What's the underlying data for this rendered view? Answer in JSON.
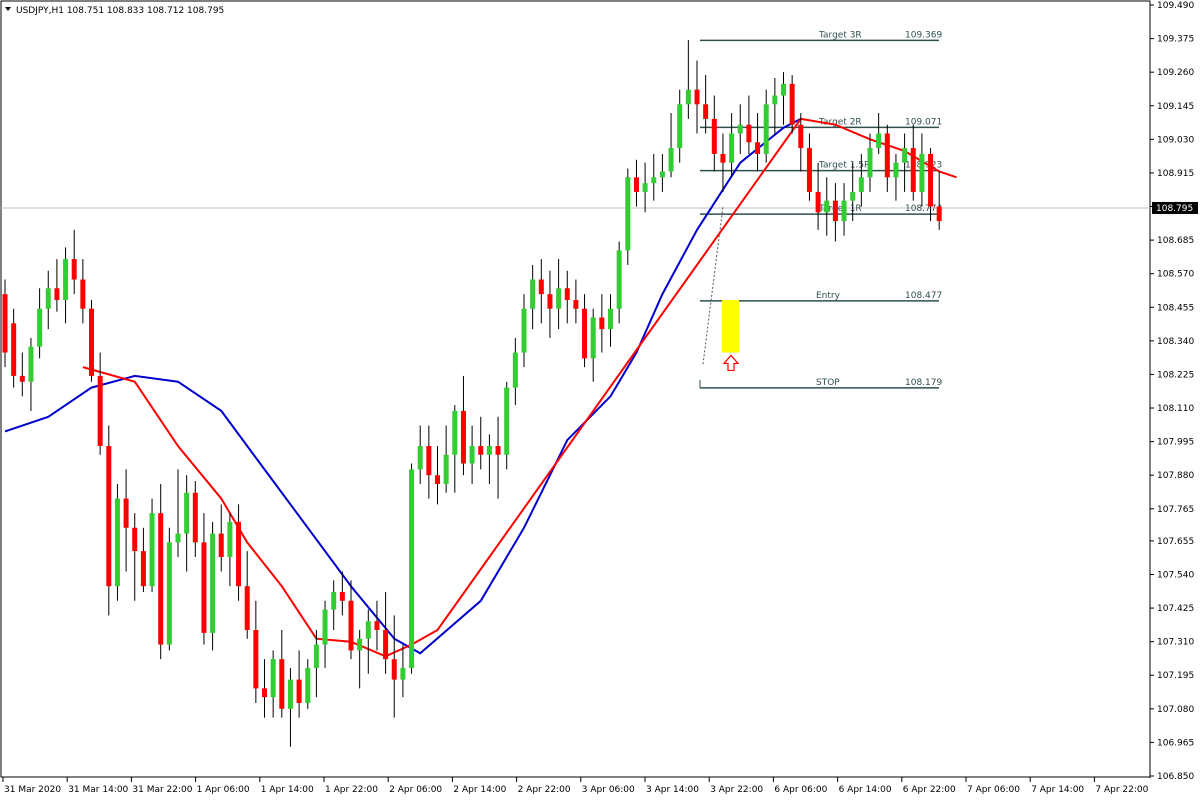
{
  "header": {
    "title": "USDJPY,H1  108.751 108.833 108.712 108.795"
  },
  "colors": {
    "bull": "#32cd32",
    "bear": "#ff0000",
    "wick": "#000000",
    "ma_fast": "#0000cd",
    "ma_slow": "#ff0000",
    "level": "#2f4f4f",
    "highlight": "#ffff00",
    "arrow": "#ff0000",
    "grid": "#c0c0c0",
    "price_line": "#c0c0c0",
    "price_tag_bg": "#000000",
    "price_tag_fg": "#ffffff"
  },
  "chart_data": {
    "type": "candlestick",
    "symbol": "USDJPY",
    "timeframe": "H1",
    "ylim": [
      106.85,
      109.49
    ],
    "y_ticks": [
      "109.490",
      "109.375",
      "109.260",
      "109.145",
      "109.030",
      "108.915",
      "108.800",
      "108.685",
      "108.570",
      "108.455",
      "108.340",
      "108.225",
      "108.110",
      "107.995",
      "107.880",
      "107.765",
      "107.655",
      "107.540",
      "107.425",
      "107.310",
      "107.195",
      "107.080",
      "106.965",
      "106.850"
    ],
    "x_ticks": [
      "31 Mar 2020",
      "31 Mar 14:00",
      "31 Mar 22:00",
      "1 Apr 06:00",
      "1 Apr 14:00",
      "1 Apr 22:00",
      "2 Apr 06:00",
      "2 Apr 14:00",
      "2 Apr 22:00",
      "3 Apr 06:00",
      "3 Apr 14:00",
      "3 Apr 22:00",
      "6 Apr 06:00",
      "6 Apr 14:00",
      "6 Apr 22:00",
      "7 Apr 06:00",
      "7 Apr 14:00",
      "7 Apr 22:00"
    ],
    "current_price": "108.795",
    "bars": [
      [
        108.5,
        108.55,
        108.25,
        108.3
      ],
      [
        108.4,
        108.45,
        108.18,
        108.22
      ],
      [
        108.22,
        108.3,
        108.15,
        108.2
      ],
      [
        108.2,
        108.35,
        108.1,
        108.32
      ],
      [
        108.32,
        108.52,
        108.28,
        108.45
      ],
      [
        108.45,
        108.58,
        108.38,
        108.52
      ],
      [
        108.52,
        108.62,
        108.44,
        108.48
      ],
      [
        108.48,
        108.66,
        108.4,
        108.62
      ],
      [
        108.62,
        108.72,
        108.5,
        108.55
      ],
      [
        108.55,
        108.62,
        108.4,
        108.45
      ],
      [
        108.45,
        108.48,
        108.2,
        108.22
      ],
      [
        108.22,
        108.3,
        107.95,
        107.98
      ],
      [
        107.98,
        108.05,
        107.4,
        107.5
      ],
      [
        107.5,
        107.85,
        107.45,
        107.8
      ],
      [
        107.8,
        107.9,
        107.55,
        107.7
      ],
      [
        107.7,
        107.75,
        107.45,
        107.62
      ],
      [
        107.62,
        107.7,
        107.48,
        107.5
      ],
      [
        107.5,
        107.8,
        107.48,
        107.75
      ],
      [
        107.75,
        107.85,
        107.25,
        107.3
      ],
      [
        107.3,
        107.7,
        107.28,
        107.65
      ],
      [
        107.65,
        107.9,
        107.6,
        107.68
      ],
      [
        107.68,
        107.88,
        107.55,
        107.82
      ],
      [
        107.82,
        107.86,
        107.6,
        107.65
      ],
      [
        107.65,
        107.75,
        107.3,
        107.34
      ],
      [
        107.34,
        107.72,
        107.28,
        107.68
      ],
      [
        107.68,
        107.78,
        107.55,
        107.6
      ],
      [
        107.6,
        107.75,
        107.5,
        107.72
      ],
      [
        107.72,
        107.78,
        107.45,
        107.5
      ],
      [
        107.5,
        107.62,
        107.32,
        107.35
      ],
      [
        107.35,
        107.45,
        107.1,
        107.15
      ],
      [
        107.15,
        107.25,
        107.05,
        107.12
      ],
      [
        107.12,
        107.28,
        107.05,
        107.25
      ],
      [
        107.25,
        107.35,
        107.05,
        107.08
      ],
      [
        107.08,
        107.22,
        106.95,
        107.18
      ],
      [
        107.18,
        107.28,
        107.05,
        107.1
      ],
      [
        107.1,
        107.25,
        107.08,
        107.22
      ],
      [
        107.22,
        107.35,
        107.12,
        107.3
      ],
      [
        107.3,
        107.45,
        107.22,
        107.42
      ],
      [
        107.42,
        107.52,
        107.35,
        107.48
      ],
      [
        107.48,
        107.55,
        107.4,
        107.45
      ],
      [
        107.45,
        107.52,
        107.25,
        107.28
      ],
      [
        107.28,
        107.35,
        107.15,
        107.32
      ],
      [
        107.32,
        107.42,
        107.2,
        107.38
      ],
      [
        107.38,
        107.45,
        107.28,
        107.35
      ],
      [
        107.35,
        107.48,
        107.2,
        107.25
      ],
      [
        107.25,
        107.4,
        107.05,
        107.18
      ],
      [
        107.18,
        107.3,
        107.12,
        107.22
      ],
      [
        107.22,
        107.92,
        107.2,
        107.9
      ],
      [
        107.9,
        108.05,
        107.85,
        107.98
      ],
      [
        107.98,
        108.05,
        107.8,
        107.88
      ],
      [
        107.88,
        107.98,
        107.78,
        107.85
      ],
      [
        107.85,
        108.05,
        107.82,
        107.95
      ],
      [
        107.95,
        108.12,
        107.82,
        108.1
      ],
      [
        108.1,
        108.22,
        107.88,
        107.92
      ],
      [
        107.92,
        108.05,
        107.85,
        107.98
      ],
      [
        107.98,
        108.08,
        107.9,
        107.95
      ],
      [
        107.95,
        108.02,
        107.85,
        107.98
      ],
      [
        107.98,
        108.08,
        107.8,
        107.95
      ],
      [
        107.95,
        108.2,
        107.9,
        108.18
      ],
      [
        108.18,
        108.35,
        108.12,
        108.3
      ],
      [
        108.3,
        108.5,
        108.25,
        108.45
      ],
      [
        108.45,
        108.6,
        108.38,
        108.55
      ],
      [
        108.55,
        108.62,
        108.4,
        108.5
      ],
      [
        108.5,
        108.58,
        108.35,
        108.45
      ],
      [
        108.45,
        108.62,
        108.38,
        108.52
      ],
      [
        108.52,
        108.58,
        108.4,
        108.48
      ],
      [
        108.48,
        108.55,
        108.4,
        108.45
      ],
      [
        108.45,
        108.5,
        108.25,
        108.28
      ],
      [
        108.28,
        108.45,
        108.2,
        108.42
      ],
      [
        108.42,
        108.5,
        108.3,
        108.38
      ],
      [
        108.38,
        108.5,
        108.32,
        108.45
      ],
      [
        108.45,
        108.68,
        108.4,
        108.65
      ],
      [
        108.65,
        108.93,
        108.6,
        108.9
      ],
      [
        108.9,
        108.96,
        108.8,
        108.85
      ],
      [
        108.85,
        108.95,
        108.78,
        108.88
      ],
      [
        108.88,
        108.98,
        108.82,
        108.9
      ],
      [
        108.9,
        108.98,
        108.85,
        108.92
      ],
      [
        108.92,
        109.12,
        108.9,
        109.0
      ],
      [
        109.0,
        109.2,
        108.95,
        109.15
      ],
      [
        109.15,
        109.37,
        109.1,
        109.2
      ],
      [
        109.2,
        109.3,
        109.05,
        109.15
      ],
      [
        109.15,
        109.25,
        109.05,
        109.1
      ],
      [
        109.1,
        109.18,
        108.92,
        108.98
      ],
      [
        108.98,
        109.05,
        108.85,
        108.95
      ],
      [
        108.95,
        109.12,
        108.9,
        109.05
      ],
      [
        109.05,
        109.15,
        108.98,
        109.08
      ],
      [
        109.08,
        109.18,
        108.98,
        109.02
      ],
      [
        109.02,
        109.12,
        108.92,
        108.98
      ],
      [
        108.98,
        109.2,
        108.95,
        109.15
      ],
      [
        109.15,
        109.24,
        109.05,
        109.18
      ],
      [
        109.18,
        109.26,
        109.08,
        109.22
      ],
      [
        109.22,
        109.25,
        109.05,
        109.08
      ],
      [
        109.08,
        109.12,
        108.92,
        109.0
      ],
      [
        109.0,
        109.05,
        108.82,
        108.85
      ],
      [
        108.85,
        108.95,
        108.72,
        108.78
      ],
      [
        108.78,
        108.9,
        108.7,
        108.82
      ],
      [
        108.82,
        108.88,
        108.68,
        108.75
      ],
      [
        108.75,
        108.88,
        108.7,
        108.82
      ],
      [
        108.82,
        108.95,
        108.75,
        108.85
      ],
      [
        108.85,
        108.98,
        108.8,
        108.9
      ],
      [
        108.9,
        109.05,
        108.85,
        109.0
      ],
      [
        109.0,
        109.12,
        108.98,
        109.05
      ],
      [
        109.05,
        109.08,
        108.85,
        108.9
      ],
      [
        108.9,
        108.98,
        108.82,
        108.95
      ],
      [
        108.95,
        109.05,
        108.85,
        109.0
      ],
      [
        109.0,
        109.08,
        108.82,
        108.85
      ],
      [
        108.85,
        109.05,
        108.8,
        108.98
      ],
      [
        108.98,
        109.0,
        108.75,
        108.8
      ],
      [
        108.8,
        108.92,
        108.72,
        108.75
      ]
    ],
    "ma_fast": [
      [
        0,
        108.03
      ],
      [
        5,
        108.08
      ],
      [
        10,
        108.18
      ],
      [
        15,
        108.22
      ],
      [
        20,
        108.2
      ],
      [
        25,
        108.1
      ],
      [
        30,
        107.9
      ],
      [
        35,
        107.7
      ],
      [
        40,
        107.5
      ],
      [
        45,
        107.32
      ],
      [
        48,
        107.27
      ],
      [
        55,
        107.45
      ],
      [
        60,
        107.7
      ],
      [
        65,
        108.0
      ],
      [
        70,
        108.15
      ],
      [
        73,
        108.3
      ],
      [
        76,
        108.5
      ],
      [
        80,
        108.72
      ],
      [
        85,
        108.95
      ],
      [
        90,
        109.07
      ],
      [
        92,
        109.1
      ]
    ],
    "ma_slow": [
      [
        9,
        108.25
      ],
      [
        15,
        108.2
      ],
      [
        20,
        107.98
      ],
      [
        25,
        107.8
      ],
      [
        28,
        107.65
      ],
      [
        32,
        107.5
      ],
      [
        36,
        107.32
      ],
      [
        40,
        107.31
      ],
      [
        44,
        107.26
      ],
      [
        47,
        107.3
      ],
      [
        50,
        107.35
      ],
      [
        92,
        109.1
      ],
      [
        96,
        109.08
      ],
      [
        100,
        109.03
      ],
      [
        104,
        108.99
      ],
      [
        108,
        108.92
      ],
      [
        110,
        108.9
      ]
    ],
    "levels": [
      {
        "label": "Target 3R",
        "value": "109.369"
      },
      {
        "label": "Target 2R",
        "value": "109.071"
      },
      {
        "label": "Target 1.5R",
        "value": "108.923"
      },
      {
        "label": "Target 1R",
        "value": "108.774"
      },
      {
        "label": "Entry",
        "value": "108.477"
      },
      {
        "label": "STOP",
        "value": "108.179"
      }
    ]
  }
}
